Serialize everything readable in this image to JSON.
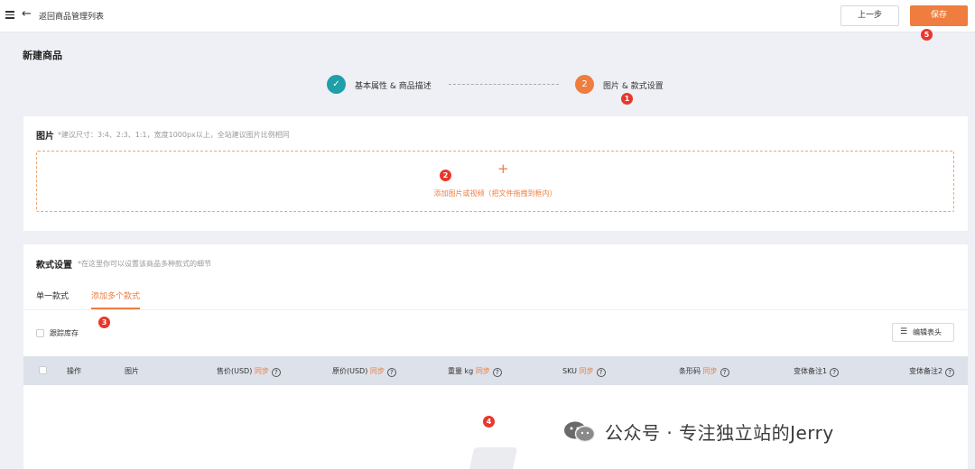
{
  "topbar": {
    "back_label": "返回商品管理列表",
    "prev_button": "上一步",
    "save_button": "保存"
  },
  "page": {
    "title": "新建商品"
  },
  "steps": [
    {
      "number": "✓",
      "label": "基本属性 & 商品描述",
      "status": "completed",
      "color": "#1f9fa8"
    },
    {
      "number": "2",
      "label": "图片 & 款式设置",
      "status": "current",
      "color": "#ee7d3f"
    }
  ],
  "images_section": {
    "title": "图片",
    "hint": "*建议尺寸：3:4、2:3、1:1，宽度1000px以上，全站建议图片比例相同",
    "upload_icon": "+",
    "upload_text": "添加图片或视频（把文件拖拽到框内）"
  },
  "variants_section": {
    "title": "款式设置",
    "hint": "*在这里你可以设置该商品多种款式的细节",
    "tabs": [
      {
        "label": "单一款式",
        "active": false
      },
      {
        "label": "添加多个款式",
        "active": true
      }
    ],
    "track_inventory_label": "跟踪库存",
    "edit_header_button": "编辑表头",
    "columns": [
      {
        "label": "操作"
      },
      {
        "label": "图片"
      },
      {
        "label": "售价(USD)",
        "sync": "同步",
        "help": "?"
      },
      {
        "label": "原价(USD)",
        "sync": "同步",
        "help": "?"
      },
      {
        "label": "重量 kg",
        "sync": "同步",
        "help": "?"
      },
      {
        "label": "SKU",
        "sync": "同步",
        "help": "?"
      },
      {
        "label": "条形码",
        "sync": "同步",
        "help": "?"
      },
      {
        "label": "变体备注1",
        "help": "?"
      },
      {
        "label": "变体备注2",
        "help": "?"
      }
    ]
  },
  "markers": [
    "1",
    "2",
    "3",
    "4",
    "5"
  ],
  "watermark": {
    "text": "公众号 · 专注独立站的Jerry"
  },
  "colors": {
    "accent": "#ee7d3f",
    "teal": "#1f9fa8",
    "marker": "#e8372b",
    "header_bg": "#dde1ea"
  }
}
